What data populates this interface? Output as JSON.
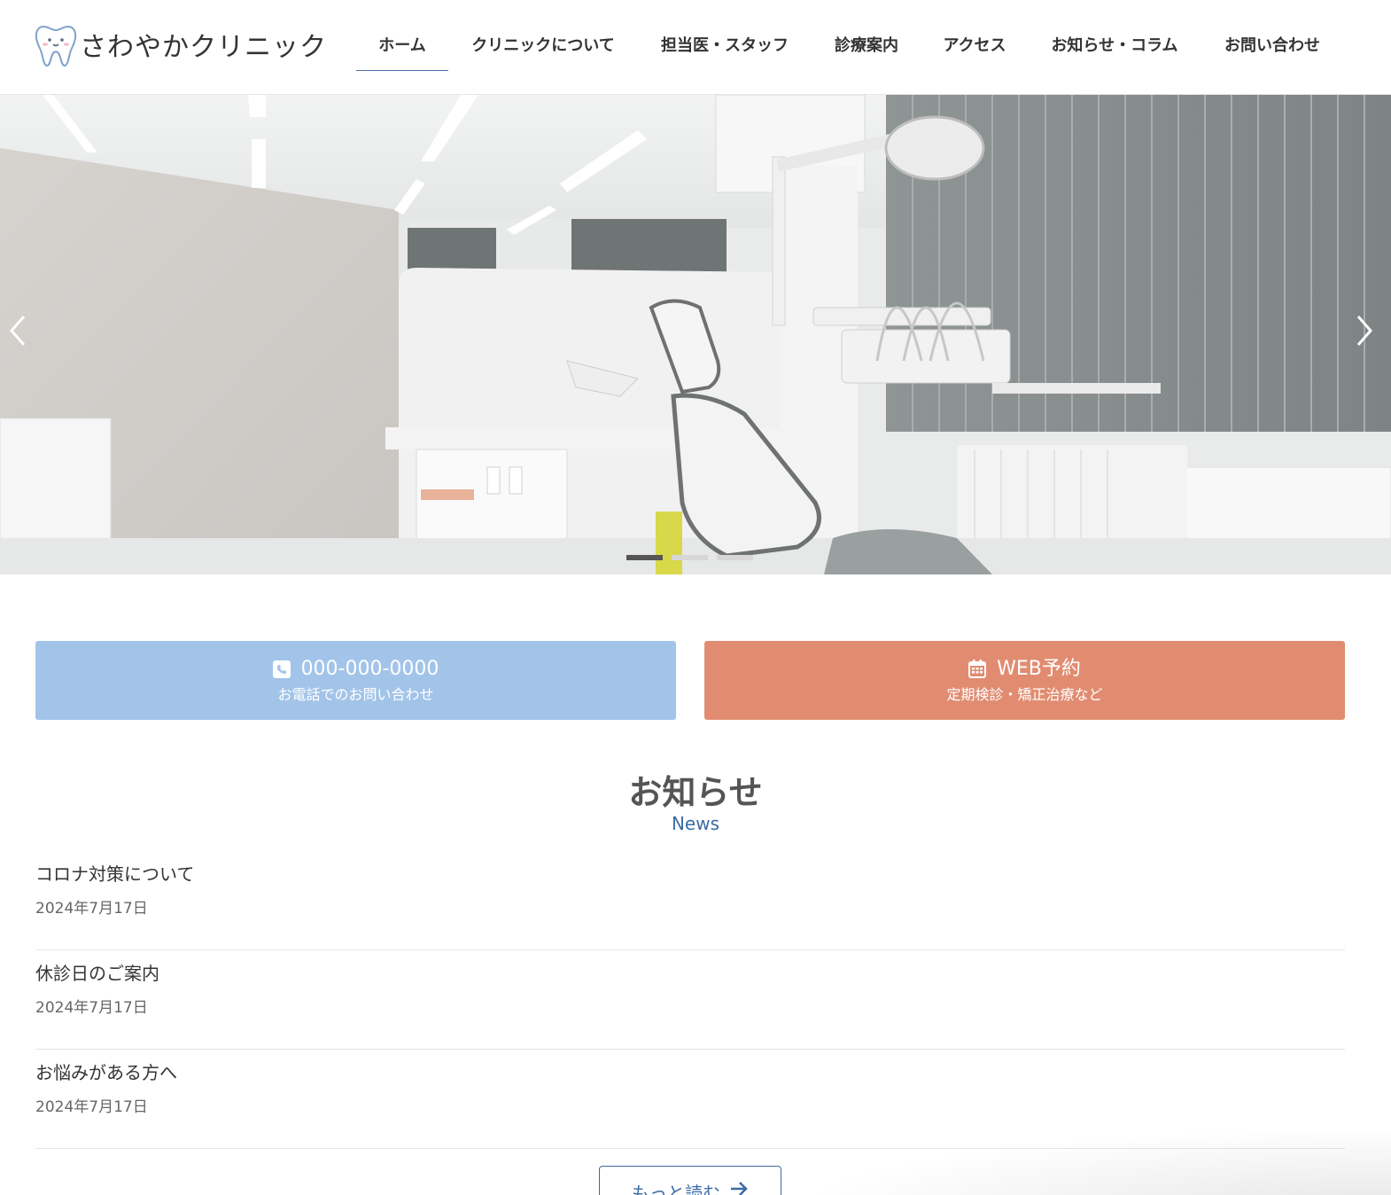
{
  "brand": {
    "name": "さわやかクリニック",
    "logo_icon": "tooth-icon"
  },
  "nav": {
    "items": [
      {
        "label": "ホーム",
        "active": true
      },
      {
        "label": "クリニックについて",
        "active": false
      },
      {
        "label": "担当医・スタッフ",
        "active": false
      },
      {
        "label": "診療案内",
        "active": false
      },
      {
        "label": "アクセス",
        "active": false
      },
      {
        "label": "お知らせ・コラム",
        "active": false
      },
      {
        "label": "お問い合わせ",
        "active": false
      }
    ]
  },
  "hero": {
    "slide_count": 3,
    "active_slide": 1,
    "prev_icon": "chevron-left-icon",
    "next_icon": "chevron-right-icon"
  },
  "cta": {
    "phone": {
      "icon": "phone-icon",
      "label": "000-000-0000",
      "sub": "お電話でのお問い合わせ",
      "color": "#a3c4e9"
    },
    "web": {
      "icon": "calendar-icon",
      "label": "WEB予約",
      "sub": "定期検診・矯正治療など",
      "color": "#e18c71"
    }
  },
  "news": {
    "title": "お知らせ",
    "subtitle": "News",
    "items": [
      {
        "title": "コロナ対策について",
        "date": "2024年7月17日"
      },
      {
        "title": "休診日のご案内",
        "date": "2024年7月17日"
      },
      {
        "title": "お悩みがある方へ",
        "date": "2024年7月17日"
      }
    ],
    "more_label": "もっと読む",
    "more_icon": "arrow-right-icon"
  },
  "colors": {
    "accent": "#3a6ba5",
    "text": "#333333"
  }
}
